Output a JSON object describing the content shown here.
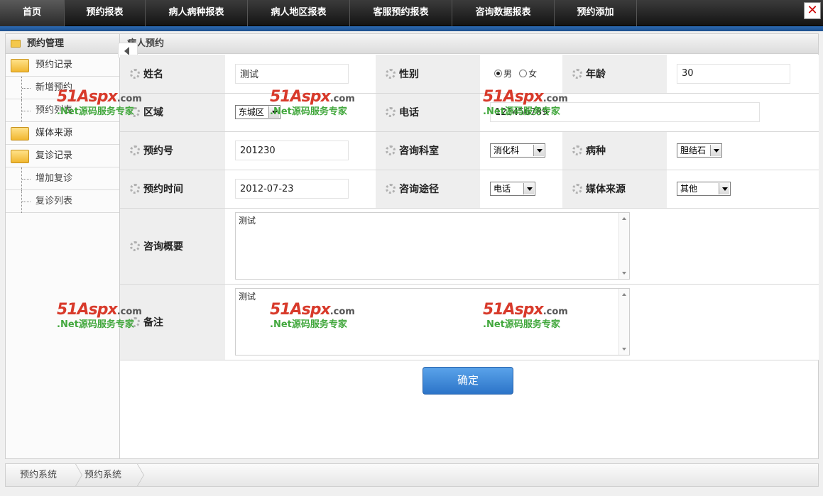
{
  "topnav": {
    "tabs": [
      "首页",
      "预约报表",
      "病人病种报表",
      "病人地区报表",
      "客服预约报表",
      "咨询数据报表",
      "预约添加"
    ],
    "close_symbol": "✕"
  },
  "sidebar": {
    "title": "预约管理",
    "items": [
      {
        "label": "预约记录",
        "type": "group"
      },
      {
        "label": "新增预约",
        "type": "sub"
      },
      {
        "label": "预约列表",
        "type": "sub"
      },
      {
        "label": "媒体来源",
        "type": "group"
      },
      {
        "label": "复诊记录",
        "type": "group"
      },
      {
        "label": "增加复诊",
        "type": "sub"
      },
      {
        "label": "复诊列表",
        "type": "sub"
      }
    ]
  },
  "main": {
    "title": "病人预约",
    "form": {
      "name_label": "姓名",
      "name_value": "测试",
      "gender_label": "性别",
      "gender_male": "男",
      "gender_female": "女",
      "gender_selected": "男",
      "age_label": "年龄",
      "age_value": "30",
      "region_label": "区域",
      "region_value": "东城区",
      "phone_label": "电话",
      "phone_value": "123456789",
      "booking_no_label": "预约号",
      "booking_no_value": "201230",
      "dept_label": "咨询科室",
      "dept_value": "消化科",
      "disease_label": "病种",
      "disease_value": "胆结石",
      "booking_time_label": "预约时间",
      "booking_time_value": "2012-07-23",
      "channel_label": "咨询途径",
      "channel_value": "电话",
      "media_label": "媒体来源",
      "media_value": "其他",
      "summary_label": "咨询概要",
      "summary_value": "测试",
      "remark_label": "备注",
      "remark_value": "测试"
    },
    "submit_label": "确定"
  },
  "watermark": {
    "brand": "51Aspx",
    "domain": ".com",
    "tagline": ".Net源码服务专家"
  },
  "footer": {
    "breadcrumbs": [
      "预约系统",
      "预约系统"
    ]
  },
  "colors": {
    "accent_blue": "#2c6bb5",
    "button_blue": "#3a86d8",
    "watermark_red": "#d83a2b",
    "watermark_green": "#43a83e"
  }
}
